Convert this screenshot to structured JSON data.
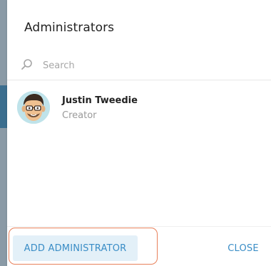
{
  "dialog": {
    "title": "Administrators",
    "search": {
      "placeholder": "Search",
      "value": ""
    },
    "admins": [
      {
        "name": "Justin Tweedie",
        "role": "Creator",
        "avatar_icon": "cartoon-face-avatar-icon"
      }
    ],
    "buttons": {
      "add_admin_label": "ADD ADMINISTRATOR",
      "close_label": "CLOSE"
    }
  },
  "colors": {
    "accent": "#3a8dc6",
    "button_bg": "#e3f0f8",
    "highlight_border": "#e8805a",
    "placeholder": "#a6a6a6"
  }
}
